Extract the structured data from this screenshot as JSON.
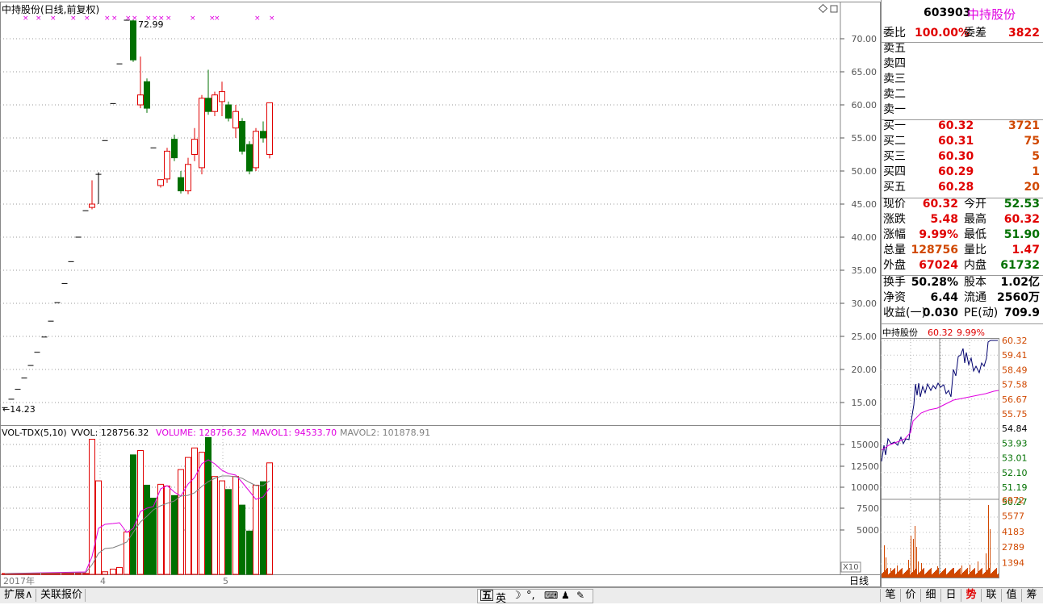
{
  "kline": {
    "title": "中持股份(日线,前复权)",
    "high_label": "72.99",
    "low_label": "14.23",
    "price_ticks": [
      "70.00",
      "65.00",
      "60.00",
      "55.00",
      "50.00",
      "45.00",
      "40.00",
      "35.00",
      "30.00",
      "25.00",
      "20.00",
      "15.00"
    ],
    "date_labels": {
      "year": "2017年",
      "m4": "4",
      "m5": "5"
    },
    "period_label": "日线",
    "colors": {
      "up": "#e00000",
      "down": "#007000",
      "ma1": "#e000e0",
      "ma2": "#808080"
    }
  },
  "volume": {
    "indicator": "VOL-TDX(5,10)",
    "vvol": "VVOL: 128756.32",
    "volume": "VOLUME: 128756.32",
    "mavol1": "MAVOL1: 94533.70",
    "mavol2": "MAVOL2: 101878.91",
    "ticks": [
      "15000",
      "12500",
      "10000",
      "7500",
      "5000"
    ],
    "multiplier": "X10"
  },
  "quote": {
    "code": "603903",
    "name": "中持股份",
    "webi_label": "委比",
    "webi": "100.00%",
    "weicha_label": "委差",
    "weicha": "3822",
    "sells": [
      "卖五",
      "卖四",
      "卖三",
      "卖二",
      "卖一"
    ],
    "buys": [
      {
        "label": "买一",
        "price": "60.32",
        "vol": "3721"
      },
      {
        "label": "买二",
        "price": "60.31",
        "vol": "75"
      },
      {
        "label": "买三",
        "price": "60.30",
        "vol": "5"
      },
      {
        "label": "买四",
        "price": "60.29",
        "vol": "1"
      },
      {
        "label": "买五",
        "price": "60.28",
        "vol": "20"
      }
    ],
    "stats": [
      {
        "l1": "现价",
        "v1": "60.32",
        "c1": "red",
        "l2": "今开",
        "v2": "52.53",
        "c2": "green"
      },
      {
        "l1": "涨跌",
        "v1": "5.48",
        "c1": "red",
        "l2": "最高",
        "v2": "60.32",
        "c2": "red"
      },
      {
        "l1": "涨幅",
        "v1": "9.99%",
        "c1": "red",
        "l2": "最低",
        "v2": "51.90",
        "c2": "green"
      },
      {
        "l1": "总量",
        "v1": "128756",
        "c1": "orange",
        "l2": "量比",
        "v2": "1.47",
        "c2": "red"
      },
      {
        "l1": "外盘",
        "v1": "67024",
        "c1": "red",
        "l2": "内盘",
        "v2": "61732",
        "c2": "green"
      }
    ],
    "fund": [
      {
        "l1": "换手",
        "v1": "50.28%",
        "l2": "股本",
        "v2": "1.02亿"
      },
      {
        "l1": "净资",
        "v1": "6.44",
        "l2": "流通",
        "v2": "2560万"
      },
      {
        "l1": "收益(一)",
        "v1": "0.030",
        "l2": "PE(动)",
        "v2": "709.9"
      }
    ]
  },
  "minute": {
    "name": "中持股份",
    "price": "60.32",
    "pct": "9.99%",
    "price_ticks_up": [
      "60.32",
      "59.41",
      "58.49",
      "57.58",
      "56.67",
      "55.75"
    ],
    "price_mid": "54.84",
    "price_ticks_down": [
      "53.93",
      "53.01",
      "52.10",
      "51.19",
      "50.27"
    ],
    "vol_ticks": [
      "6972",
      "5577",
      "4183",
      "2789",
      "1394"
    ]
  },
  "statusbar": {
    "expand": "扩展∧",
    "related": "关联报价",
    "ime_lang": "英",
    "tabs": [
      "笔",
      "价",
      "细",
      "日",
      "势",
      "联",
      "值",
      "筹"
    ],
    "active_tab": "势"
  }
}
